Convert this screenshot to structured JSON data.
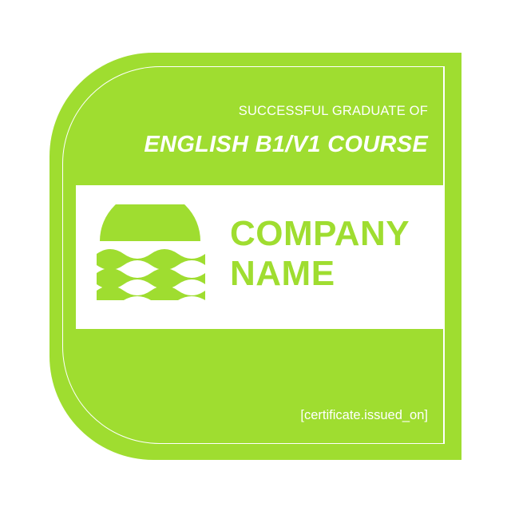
{
  "certificate": {
    "subtitle": "SUCCESSFUL GRADUATE OF",
    "title": "ENGLISH B1/V1 COURSE",
    "company_line1": "COMPANY",
    "company_line2": "NAME",
    "issued_on": "[certificate.issued_on]"
  },
  "colors": {
    "accent": "#9fdd30",
    "background": "#ffffff",
    "text_on_accent": "#ffffff"
  },
  "icons": {
    "logo": "sun-over-waves-icon"
  }
}
